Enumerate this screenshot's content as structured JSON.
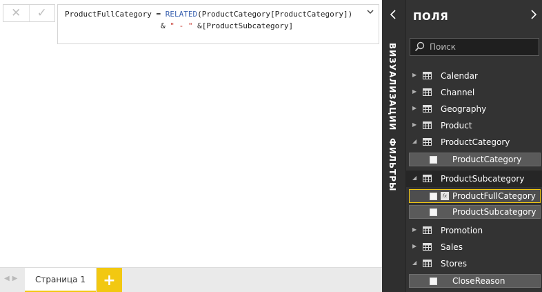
{
  "formula_bar": {
    "cancel_icon": "x-icon",
    "commit_icon": "check-icon",
    "line1_measure": "ProductFullCategory",
    "line1_eq": " = ",
    "line1_func": "RELATED",
    "line1_args": "(ProductCategory[ProductCategory])",
    "line2_indent": "                     ",
    "line2_amp1": "& ",
    "line2_string": "\" - \"",
    "line2_rest": " &[ProductSubcategory]",
    "expand_icon": "chevron-down-icon"
  },
  "pages": {
    "tab_label": "Страница 1",
    "add_label": "+"
  },
  "side_strip": {
    "visualizations_label": "ВИЗУАЛИЗАЦИИ",
    "filters_label": "ФИЛЬТРЫ"
  },
  "fields_pane": {
    "title": "ПОЛЯ",
    "search_placeholder": "Поиск",
    "tables": [
      {
        "name": "Calendar",
        "expanded": false
      },
      {
        "name": "Channel",
        "expanded": false
      },
      {
        "name": "Geography",
        "expanded": false
      },
      {
        "name": "Product",
        "expanded": false
      },
      {
        "name": "ProductCategory",
        "expanded": true
      },
      {
        "name": "ProductSubcategory",
        "expanded": true
      },
      {
        "name": "Promotion",
        "expanded": false
      },
      {
        "name": "Sales",
        "expanded": false
      },
      {
        "name": "Stores",
        "expanded": true
      }
    ],
    "fields": {
      "productcategory": "ProductCategory",
      "productfullcategory": "ProductFullCategory",
      "productsubcategory": "ProductSubcategory",
      "closereason": "CloseReason"
    }
  },
  "colors": {
    "accent": "#f2c811",
    "pane_bg": "#333333",
    "strip_bg": "#2f2f2f"
  }
}
